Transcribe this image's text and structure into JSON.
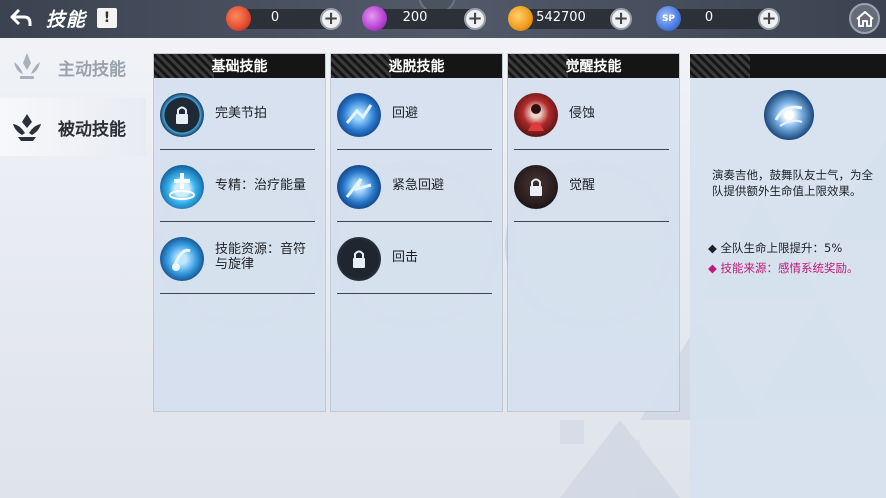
{
  "header": {
    "title": "技能",
    "help_label": "!",
    "currencies": [
      {
        "name": "fire",
        "value": "0",
        "color": "#e24a32"
      },
      {
        "name": "crystal",
        "value": "200",
        "color": "#b63ed1"
      },
      {
        "name": "coin",
        "value": "542700",
        "color": "#f09a1c"
      },
      {
        "name": "sp",
        "value": "0",
        "color": "#4a7be0",
        "icon_text": "SP"
      }
    ]
  },
  "sidebar": {
    "items": [
      {
        "label": "主动技能",
        "active": false
      },
      {
        "label": "被动技能",
        "active": true
      }
    ]
  },
  "columns": [
    {
      "title": "基础技能",
      "skills": [
        {
          "name": "完美节拍",
          "locked": true,
          "icon": "lock-icon"
        },
        {
          "name": "专精：治疗能量",
          "locked": false,
          "icon": "heal-energy-icon"
        },
        {
          "name": "技能资源：音符与旋律",
          "locked": false,
          "icon": "notes-icon"
        }
      ]
    },
    {
      "title": "逃脱技能",
      "skills": [
        {
          "name": "回避",
          "locked": false,
          "icon": "dodge-icon"
        },
        {
          "name": "紧急回避",
          "locked": false,
          "icon": "emergency-dodge-icon"
        },
        {
          "name": "回击",
          "locked": true,
          "icon": "lock-icon"
        }
      ]
    },
    {
      "title": "觉醒技能",
      "skills": [
        {
          "name": "侵蚀",
          "locked": false,
          "icon": "erosion-icon"
        },
        {
          "name": "觉醒",
          "locked": true,
          "icon": "lock-icon"
        }
      ]
    }
  ],
  "detail": {
    "description": "演奏吉他，鼓舞队友士气，为全队提供额外生命值上限效果。",
    "bullets": [
      {
        "text": "◆ 全队生命上限提升：5%",
        "highlight": false
      },
      {
        "text": "◆ 技能来源：感情系统奖励。",
        "highlight": true
      }
    ]
  }
}
